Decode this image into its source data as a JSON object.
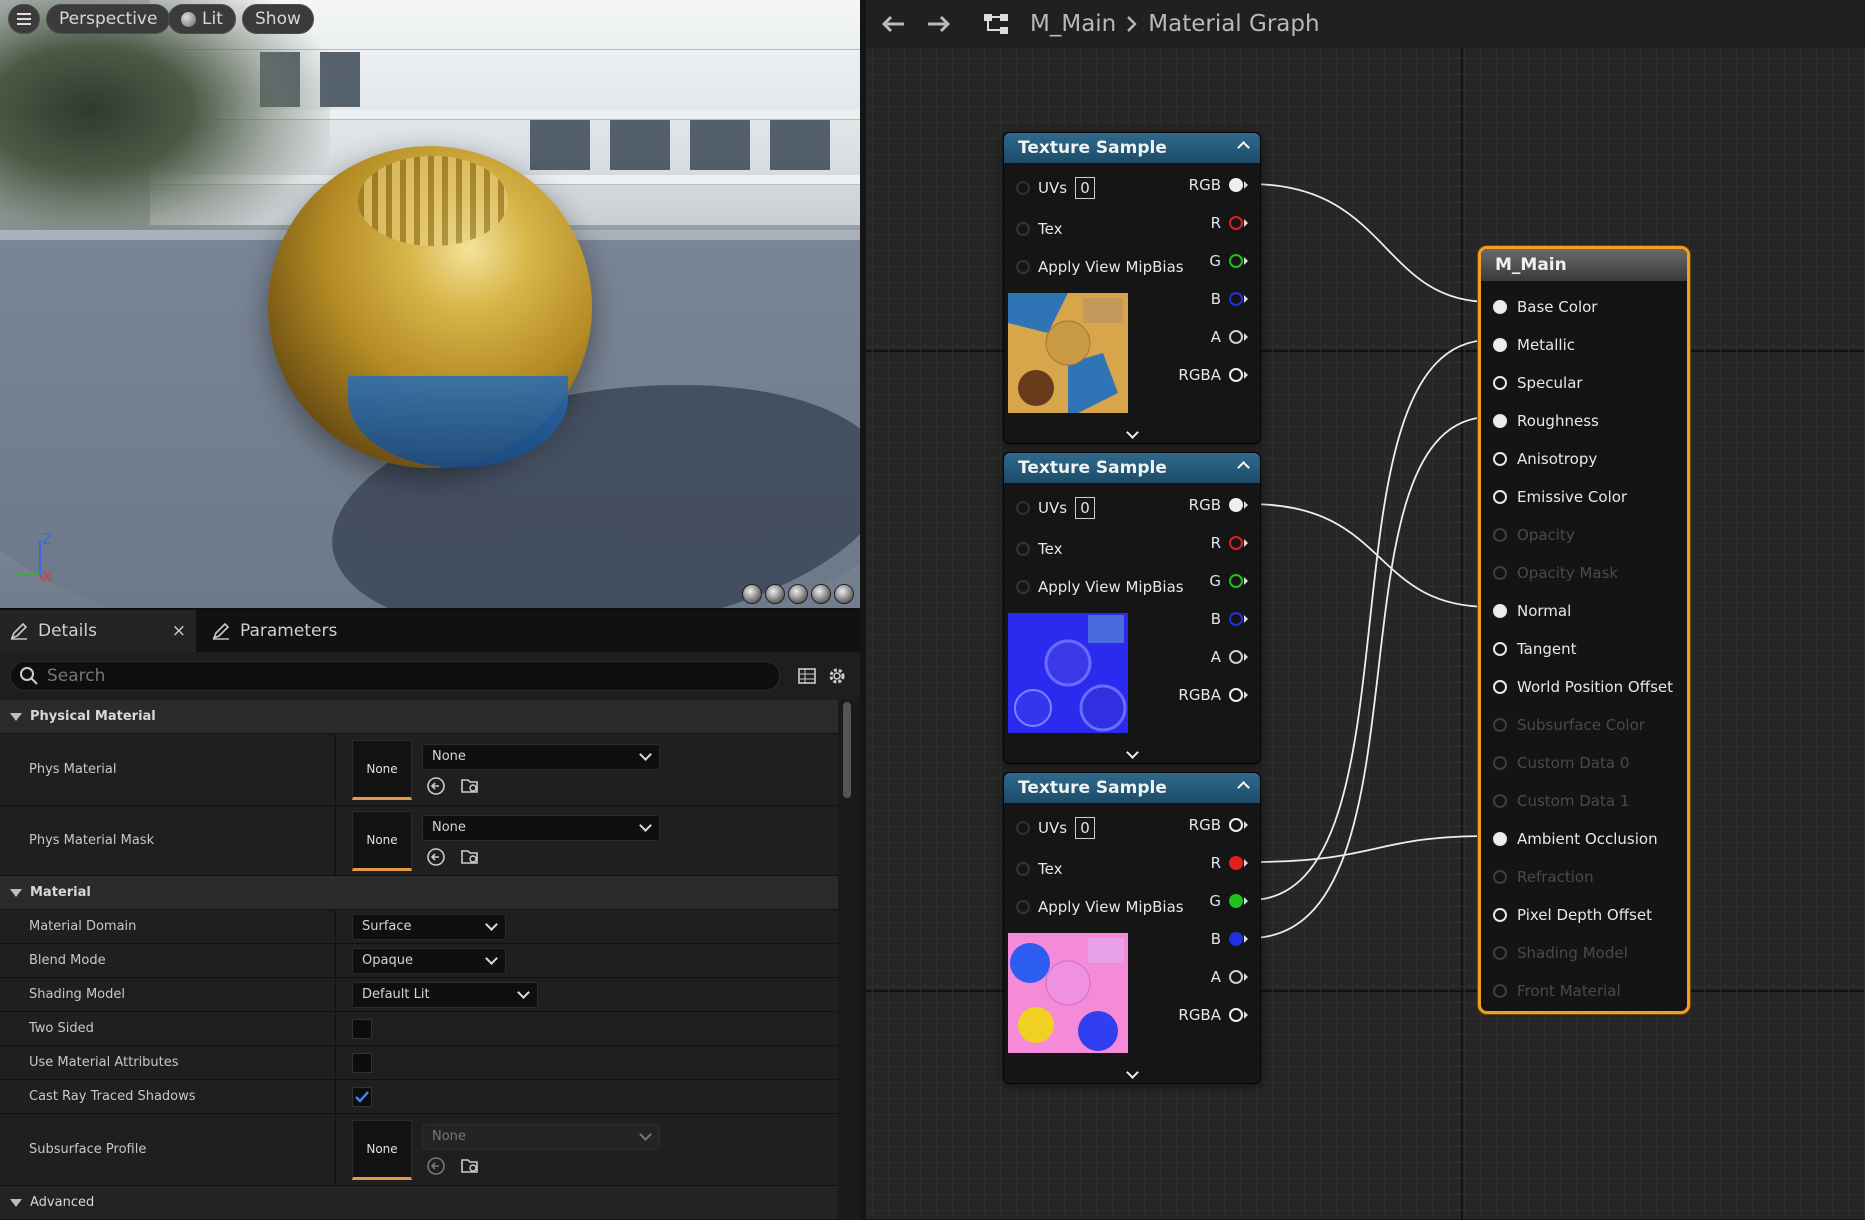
{
  "viewport": {
    "menu_icon": "hamburger-icon",
    "perspective": "Perspective",
    "lit": "Lit",
    "show": "Show",
    "axis_z": "Z",
    "axis_x": "X"
  },
  "details": {
    "tab_details": "Details",
    "tab_parameters": "Parameters",
    "search_placeholder": "Search",
    "sections": {
      "physical_material": "Physical Material",
      "material": "Material",
      "advanced": "Advanced"
    },
    "props": {
      "phys_material": {
        "label": "Phys Material",
        "thumb": "None",
        "value": "None"
      },
      "phys_material_mask": {
        "label": "Phys Material Mask",
        "thumb": "None",
        "value": "None"
      },
      "material_domain": {
        "label": "Material Domain",
        "value": "Surface"
      },
      "blend_mode": {
        "label": "Blend Mode",
        "value": "Opaque"
      },
      "shading_model": {
        "label": "Shading Model",
        "value": "Default Lit"
      },
      "two_sided": {
        "label": "Two Sided",
        "checked": false
      },
      "use_material_attributes": {
        "label": "Use Material Attributes",
        "checked": false
      },
      "cast_ray_traced_shadows": {
        "label": "Cast Ray Traced Shadows",
        "checked": true
      },
      "subsurface_profile": {
        "label": "Subsurface Profile",
        "thumb": "None",
        "value": "None"
      }
    }
  },
  "graph": {
    "breadcrumb_root": "M_Main",
    "breadcrumb_current": "Material Graph",
    "texture_node_title": "Texture Sample",
    "tex_inputs": {
      "uvs": "UVs",
      "uvs_value": "0",
      "tex": "Tex",
      "mip": "Apply View MipBias"
    },
    "tex_outputs": {
      "rgb": "RGB",
      "r": "R",
      "g": "G",
      "b": "B",
      "a": "A",
      "rgba": "RGBA"
    },
    "pin_colors": {
      "r": "#e02020",
      "g": "#20c020",
      "b": "#2030e0",
      "white": "#eeeeee"
    },
    "main_node": {
      "title": "M_Main",
      "inputs": [
        {
          "label": "Base Color",
          "state": "connected"
        },
        {
          "label": "Metallic",
          "state": "connected"
        },
        {
          "label": "Specular",
          "state": "active"
        },
        {
          "label": "Roughness",
          "state": "connected"
        },
        {
          "label": "Anisotropy",
          "state": "active"
        },
        {
          "label": "Emissive Color",
          "state": "active"
        },
        {
          "label": "Opacity",
          "state": "disabled"
        },
        {
          "label": "Opacity Mask",
          "state": "disabled"
        },
        {
          "label": "Normal",
          "state": "connected"
        },
        {
          "label": "Tangent",
          "state": "active"
        },
        {
          "label": "World Position Offset",
          "state": "active"
        },
        {
          "label": "Subsurface Color",
          "state": "disabled"
        },
        {
          "label": "Custom Data 0",
          "state": "disabled"
        },
        {
          "label": "Custom Data 1",
          "state": "disabled"
        },
        {
          "label": "Ambient Occlusion",
          "state": "connected"
        },
        {
          "label": "Refraction",
          "state": "disabled"
        },
        {
          "label": "Pixel Depth Offset",
          "state": "active"
        },
        {
          "label": "Shading Model",
          "state": "disabled"
        },
        {
          "label": "Front Material",
          "state": "disabled"
        }
      ]
    }
  }
}
